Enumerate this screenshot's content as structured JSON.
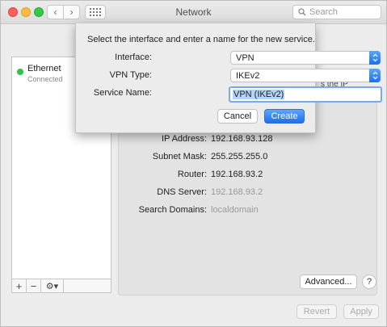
{
  "window": {
    "title": "Network"
  },
  "search": {
    "placeholder": "Search"
  },
  "sidebar": {
    "services": [
      {
        "name": "Ethernet",
        "status": "Connected",
        "status_color": "#2ec44a"
      }
    ],
    "tools": {
      "add": "+",
      "remove": "−",
      "gear": "⚙▾"
    }
  },
  "sheet": {
    "prompt": "Select the interface and enter a name for the new service.",
    "interface_label": "Interface:",
    "interface_value": "VPN",
    "vpn_type_label": "VPN Type:",
    "vpn_type_value": "IKEv2",
    "service_name_label": "Service Name:",
    "service_name_value": "VPN (IKEv2)",
    "cancel_label": "Cancel",
    "create_label": "Create"
  },
  "behind": {
    "partial_text": "s the IP"
  },
  "details": {
    "ip_address_label": "IP Address:",
    "ip_address_value": "192.168.93.128",
    "subnet_mask_label": "Subnet Mask:",
    "subnet_mask_value": "255.255.255.0",
    "router_label": "Router:",
    "router_value": "192.168.93.2",
    "dns_server_label": "DNS Server:",
    "dns_server_value": "192.168.93.2",
    "search_domains_label": "Search Domains:",
    "search_domains_value": "localdomain"
  },
  "buttons": {
    "advanced_label": "Advanced...",
    "help_label": "?",
    "revert_label": "Revert",
    "apply_label": "Apply"
  },
  "colors": {
    "accent": "#1e6ee8",
    "status_green": "#2ec44a"
  }
}
